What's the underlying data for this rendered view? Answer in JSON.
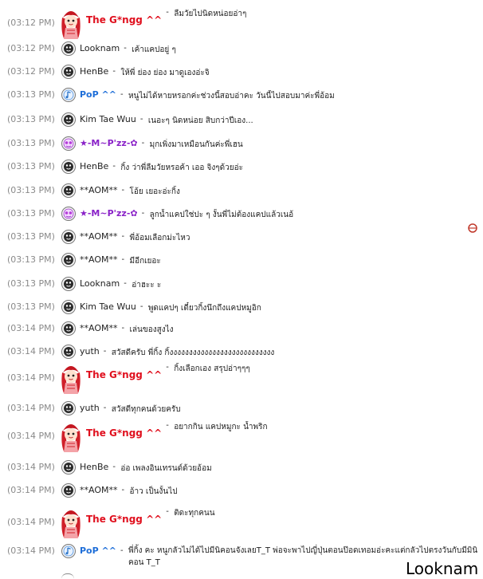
{
  "messages": [
    {
      "time": "(03:12 PM)",
      "user": "The G*ngg ^^",
      "style": "red",
      "avatar": "big",
      "text": "ลืมวัยไปนิดหน่อยอ่าๆ"
    },
    {
      "time": "(03:12 PM)",
      "user": "Looknam",
      "style": "plain",
      "avatar": "smiley",
      "text": "เค้าแคปอยู่ ๆ"
    },
    {
      "time": "(03:12 PM)",
      "user": "HenBe",
      "style": "plain",
      "avatar": "smiley",
      "text": "ให้พี่ ย่อง ย่อง มาดูเองอ่ะจิ"
    },
    {
      "time": "(03:13 PM)",
      "user": "PoP ^^",
      "style": "blue",
      "avatar": "note",
      "text": "หนูไม่ได้หายหรอกค่ะช่วงนี้สอบอ่าคะ วันนี้ไปสอบมาค่ะพี่อ้อม"
    },
    {
      "time": "(03:13 PM)",
      "user": "Kim Tae Wuu",
      "style": "plain",
      "avatar": "smiley",
      "text": "เนอะๆ นิดหน่อย สิบกว่าปีเอง..."
    },
    {
      "time": "(03:13 PM)",
      "user": "★-M~P'zz-✿",
      "style": "purple",
      "avatar": "purple",
      "text": "มุกเพิ่งมาเหมือนกันค่ะพี่เฮน"
    },
    {
      "time": "(03:13 PM)",
      "user": "HenBe",
      "style": "plain",
      "avatar": "smiley",
      "text": "กิ้ง ว่าพี่ลืมวัยหรอค้า เออ จิงๆด้วยอ่ะ"
    },
    {
      "time": "(03:13 PM)",
      "user": "**AOM**",
      "style": "plain",
      "avatar": "smiley",
      "text": "โอ้ย เยอะอ่ะกิ้ง"
    },
    {
      "time": "(03:13 PM)",
      "user": "★-M~P'zz-✿",
      "style": "purple",
      "avatar": "purple",
      "text": "ลูกน้ำแคปใช่ปะ ๆ งั้นพี่ไม่ต้องแคปแล้วเนอ้"
    },
    {
      "time": "(03:13 PM)",
      "user": "**AOM**",
      "style": "plain",
      "avatar": "smiley",
      "text": "พี่อ้อมเลือกม่ะไหว"
    },
    {
      "time": "(03:13 PM)",
      "user": "**AOM**",
      "style": "plain",
      "avatar": "smiley",
      "text": "มีอีกเยอะ"
    },
    {
      "time": "(03:13 PM)",
      "user": "Looknam",
      "style": "plain",
      "avatar": "smiley",
      "text": "อ่าฮะะ ะ"
    },
    {
      "time": "(03:13 PM)",
      "user": "Kim Tae Wuu",
      "style": "plain",
      "avatar": "smiley",
      "text": "พูดแคปๆ เดี๋ยวกิ้งนึกถึงแคปหมูอิก"
    },
    {
      "time": "(03:14 PM)",
      "user": "**AOM**",
      "style": "plain",
      "avatar": "smiley",
      "text": "เล่นของสูงไง"
    },
    {
      "time": "(03:14 PM)",
      "user": "yuth",
      "style": "plain",
      "avatar": "smiley",
      "text": "สวัสดีครับ พี่กิ้ง กิ้งงงงงงงงงงงงงงงงงงงงงงงงงงง"
    },
    {
      "time": "(03:14 PM)",
      "user": "The G*ngg ^^",
      "style": "red",
      "avatar": "big",
      "text": "กิ้งเลือกเอง สรุปอ่าๆๆๆ"
    },
    {
      "time": "(03:14 PM)",
      "user": "yuth",
      "style": "plain",
      "avatar": "smiley",
      "text": "สวัสดีทุกคนด้วยครับ"
    },
    {
      "time": "(03:14 PM)",
      "user": "The G*ngg ^^",
      "style": "red",
      "avatar": "big",
      "text": "อยากกิน แคปหมูกะ น้ำพริก"
    },
    {
      "time": "(03:14 PM)",
      "user": "HenBe",
      "style": "plain",
      "avatar": "smiley",
      "text": "อ่อ เพลงอินเทรนด์ด้วยอ้อม"
    },
    {
      "time": "(03:14 PM)",
      "user": "**AOM**",
      "style": "plain",
      "avatar": "smiley",
      "text": "อ้าว เป็นงั้นไป"
    },
    {
      "time": "(03:14 PM)",
      "user": "The G*ngg ^^",
      "style": "red",
      "avatar": "big",
      "text": "ติดะทุกคนน"
    },
    {
      "time": "(03:14 PM)",
      "user": "PoP ^^",
      "style": "blue",
      "avatar": "note",
      "text": "พี่กิ้ง คะ หนูกลัวไม่ได้ไปมีนิคอนจังเลยT_T พ่อจะพาไปญี่ปุ่นตอนป๊อดเทอมอ่ะคะแต่กลัวไปตรงวันกับมีมินิคอน T_T"
    }
  ],
  "separator": "-",
  "caption": "Looknam"
}
